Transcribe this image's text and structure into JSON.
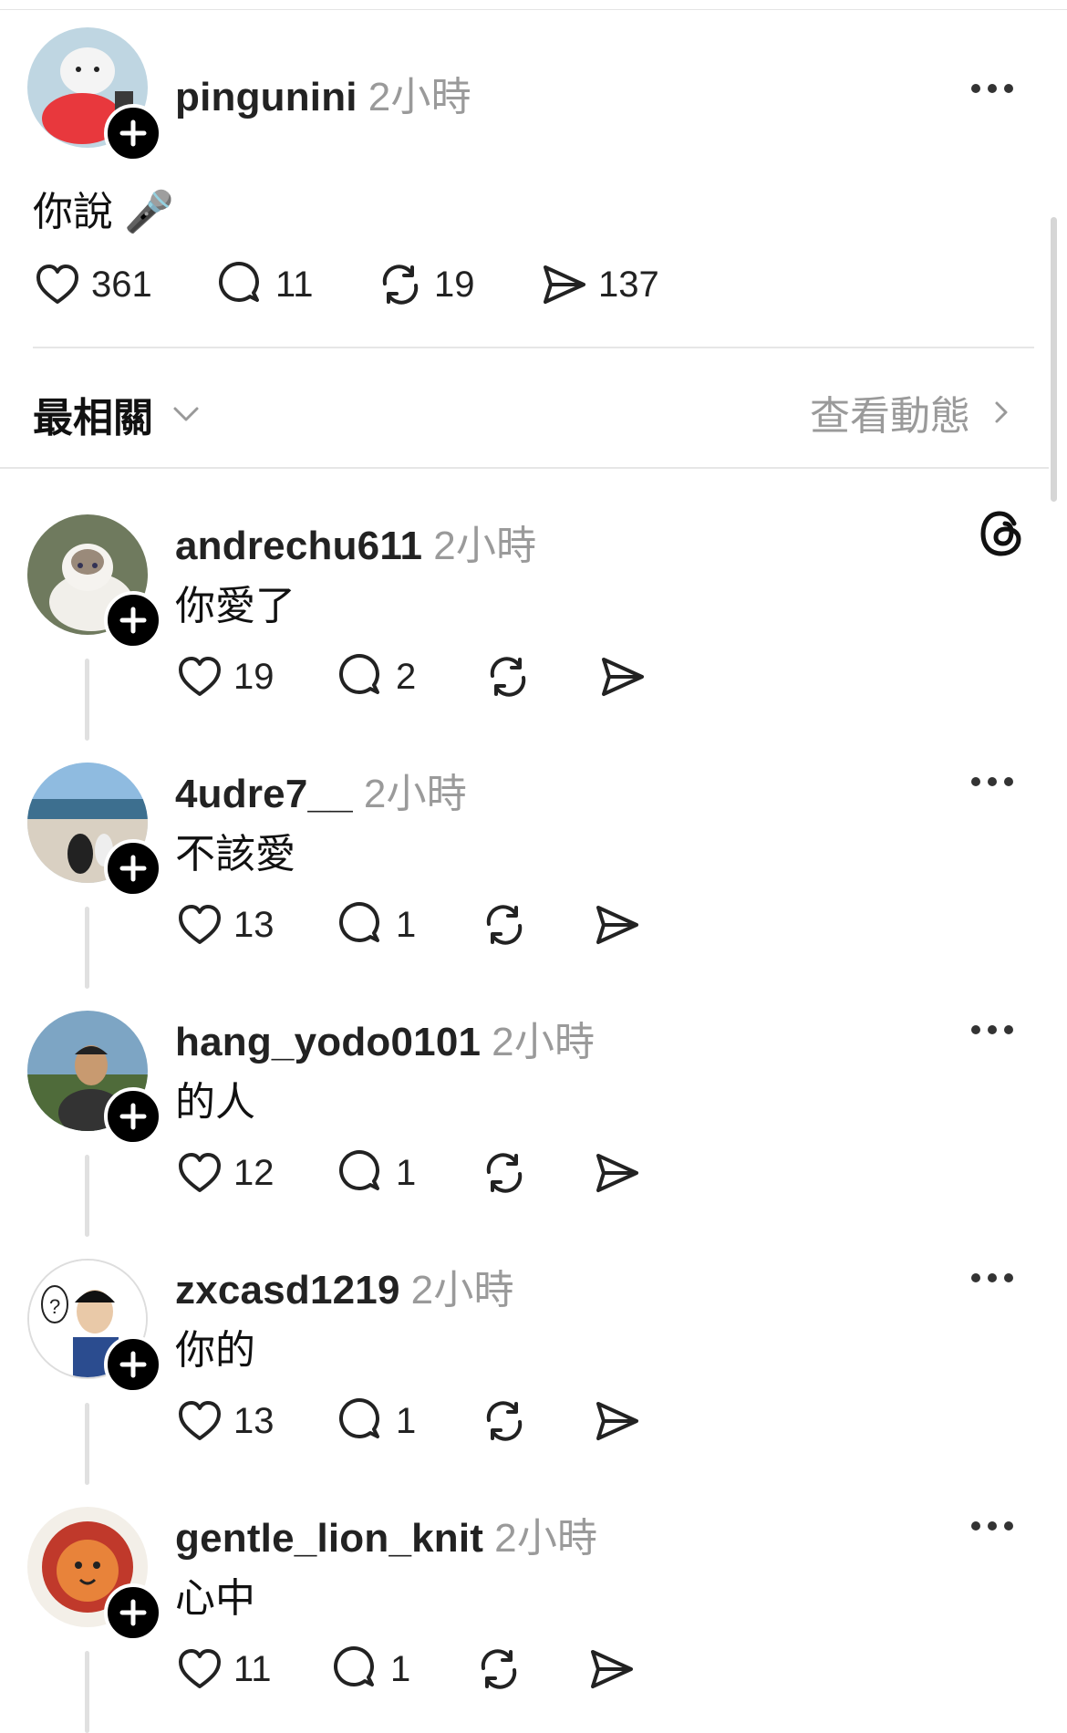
{
  "post": {
    "username": "pingunini",
    "time": "2小時",
    "text": "你說 🎤",
    "likes": "361",
    "replies": "11",
    "reposts": "19",
    "shares": "137"
  },
  "sort": {
    "label": "最相關",
    "activity_label": "查看動態"
  },
  "comments": [
    {
      "username": "andrechu611",
      "time": "2小時",
      "text": "你愛了",
      "likes": "19",
      "replies": "2"
    },
    {
      "username": "4udre7__",
      "time": "2小時",
      "text": "不該愛",
      "likes": "13",
      "replies": "1"
    },
    {
      "username": "hang_yodo0101",
      "time": "2小時",
      "text": "的人",
      "likes": "12",
      "replies": "1"
    },
    {
      "username": "zxcasd1219",
      "time": "2小時",
      "text": "你的",
      "likes": "13",
      "replies": "1"
    },
    {
      "username": "gentle_lion_knit",
      "time": "2小時",
      "text": "心中",
      "likes": "11",
      "replies": "1"
    }
  ],
  "icons": {
    "like": "heart-icon",
    "reply": "comment-icon",
    "repost": "repost-icon",
    "share": "send-icon",
    "more": "more-icon",
    "follow": "plus-icon",
    "sort": "chevron-down-icon",
    "activity": "chevron-right-icon",
    "threads": "threads-logo-icon"
  }
}
